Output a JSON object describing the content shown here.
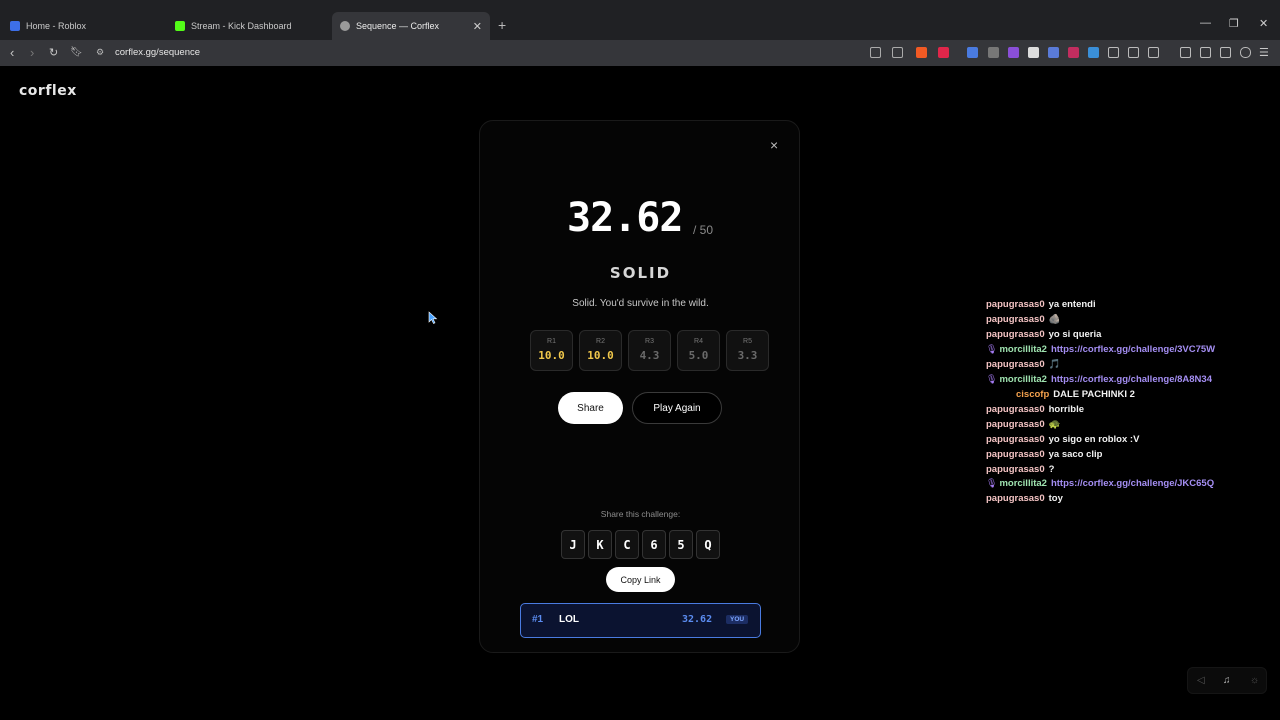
{
  "browser": {
    "tabs": [
      {
        "label": "Home - Roblox",
        "color": "#3d6fe8"
      },
      {
        "label": "Stream - Kick Dashboard",
        "color": "#53fc18"
      },
      {
        "label": "Sequence — Corflex",
        "color": "#9a9a9a"
      }
    ],
    "url": "corflex.gg/sequence"
  },
  "page": {
    "logo": "corflex",
    "modal": {
      "close": "×",
      "score": "32.62",
      "out_of": "/ 50",
      "rank": "SOLID",
      "tagline": "Solid. You'd survive in the wild.",
      "rounds": [
        {
          "label": "R1",
          "value": "10.0",
          "color": "#f1c84b"
        },
        {
          "label": "R2",
          "value": "10.0",
          "color": "#f1c84b"
        },
        {
          "label": "R3",
          "value": "4.3",
          "color": "#6a6a6a"
        },
        {
          "label": "R4",
          "value": "5.0",
          "color": "#6a6a6a"
        },
        {
          "label": "R5",
          "value": "3.3",
          "color": "#6a6a6a"
        }
      ],
      "share_label": "Share",
      "play_again_label": "Play Again",
      "share_challenge_label": "Share this challenge:",
      "code": [
        "J",
        "K",
        "C",
        "6",
        "5",
        "Q"
      ],
      "copy_link_label": "Copy Link",
      "leaderboard": {
        "position": "#1",
        "name": "LOL",
        "score": "32.62",
        "badge": "YOU"
      }
    }
  },
  "chat": [
    {
      "user": "papugrasas0",
      "text": "ya entendi",
      "style": "pink"
    },
    {
      "user": "papugrasas0",
      "text": "🪨",
      "style": "pink"
    },
    {
      "user": "papugrasas0",
      "text": "yo si queria",
      "style": "pink"
    },
    {
      "user": "morcillita2",
      "text": "https://corflex.gg/challenge/3VC75W",
      "style": "green",
      "link": true,
      "badge": true
    },
    {
      "user": "papugrasas0",
      "text": "🎵",
      "style": "pink"
    },
    {
      "user": "morcillita2",
      "text": "https://corflex.gg/challenge/8A8N34",
      "style": "green",
      "link": true,
      "badge": true
    },
    {
      "user": "ciscofp",
      "text": "DALE PACHINKI 2",
      "style": "orange"
    },
    {
      "user": "papugrasas0",
      "text": "horrible",
      "style": "pink"
    },
    {
      "user": "papugrasas0",
      "text": "🐢",
      "style": "pink"
    },
    {
      "user": "papugrasas0",
      "text": "yo sigo en roblox :V",
      "style": "pink"
    },
    {
      "user": "papugrasas0",
      "text": "ya saco clip",
      "style": "pink"
    },
    {
      "user": "papugrasas0",
      "text": "?",
      "style": "pink"
    },
    {
      "user": "morcillita2",
      "text": "https://corflex.gg/challenge/JKC65Q",
      "style": "green",
      "link": true,
      "badge": true
    },
    {
      "user": "papugrasas0",
      "text": "toy",
      "style": "pink"
    }
  ]
}
